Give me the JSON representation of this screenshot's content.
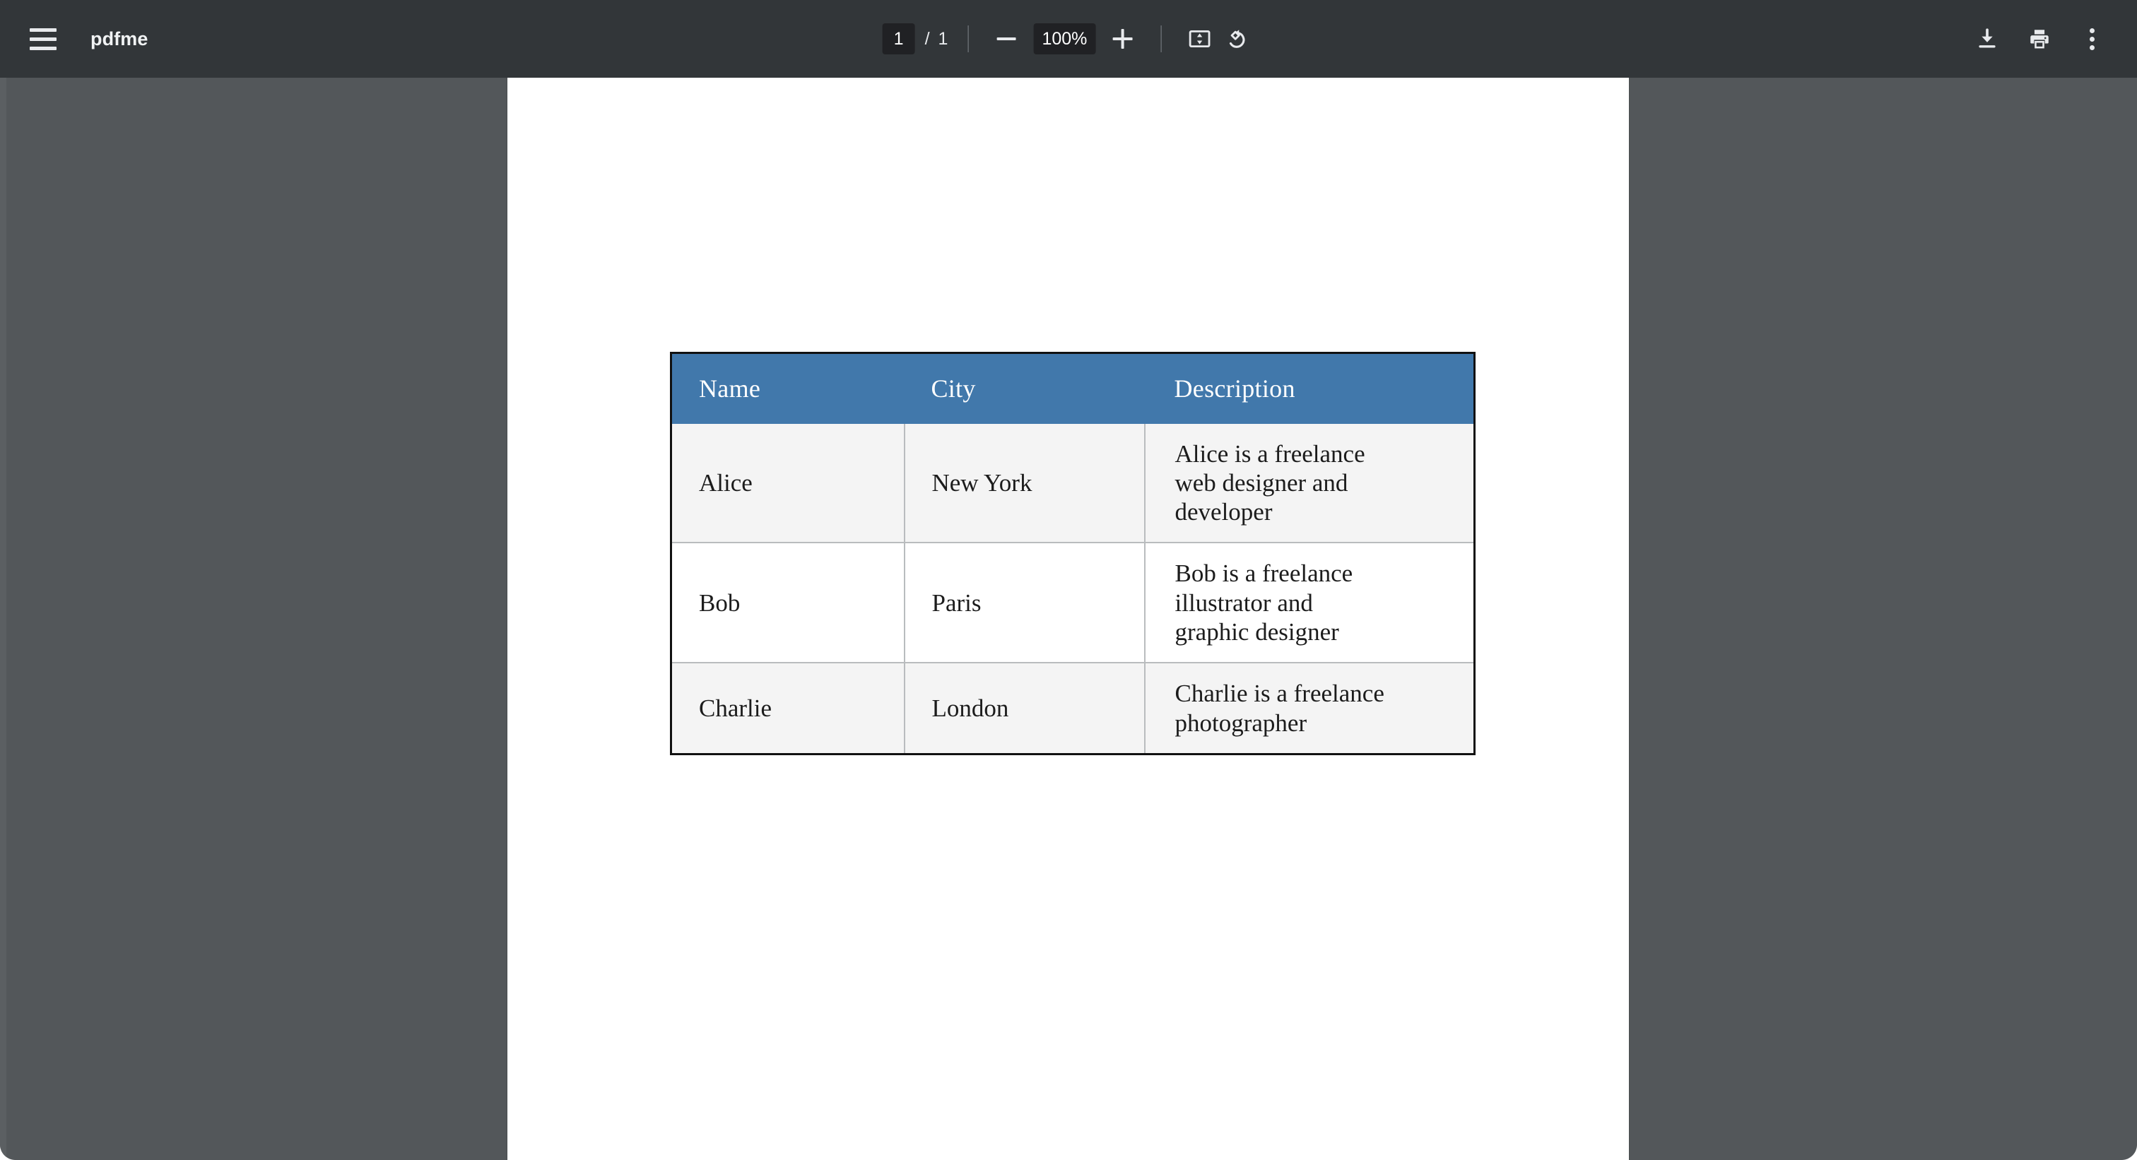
{
  "app": {
    "title": "pdfme",
    "menu_icon": "hamburger-menu-icon"
  },
  "toolbar": {
    "page_current": "1",
    "page_separator": "/",
    "page_total": "1",
    "zoom_out_icon": "minus-icon",
    "zoom_level": "100%",
    "zoom_in_icon": "plus-icon",
    "fit_page_icon": "fit-to-page-icon",
    "rotate_icon": "rotate-counterclockwise-icon",
    "download_icon": "download-icon",
    "print_icon": "print-icon",
    "more_icon": "kebab-menu-icon"
  },
  "document": {
    "table": {
      "header_bg": "#4178ab",
      "header_text_color": "#ffffff",
      "border_color": "#111111",
      "row_alt_bg": "#f4f4f4",
      "columns": [
        "Name",
        "City",
        "Description"
      ],
      "rows": [
        {
          "name": "Alice",
          "city": "New York",
          "description_lines": [
            "Alice is a freelance",
            "web designer and",
            "developer"
          ]
        },
        {
          "name": "Bob",
          "city": "Paris",
          "description_lines": [
            "Bob is a freelance",
            "illustrator and",
            "graphic designer"
          ]
        },
        {
          "name": "Charlie",
          "city": "London",
          "description_lines": [
            "Charlie is a freelance",
            "photographer"
          ]
        }
      ]
    }
  }
}
